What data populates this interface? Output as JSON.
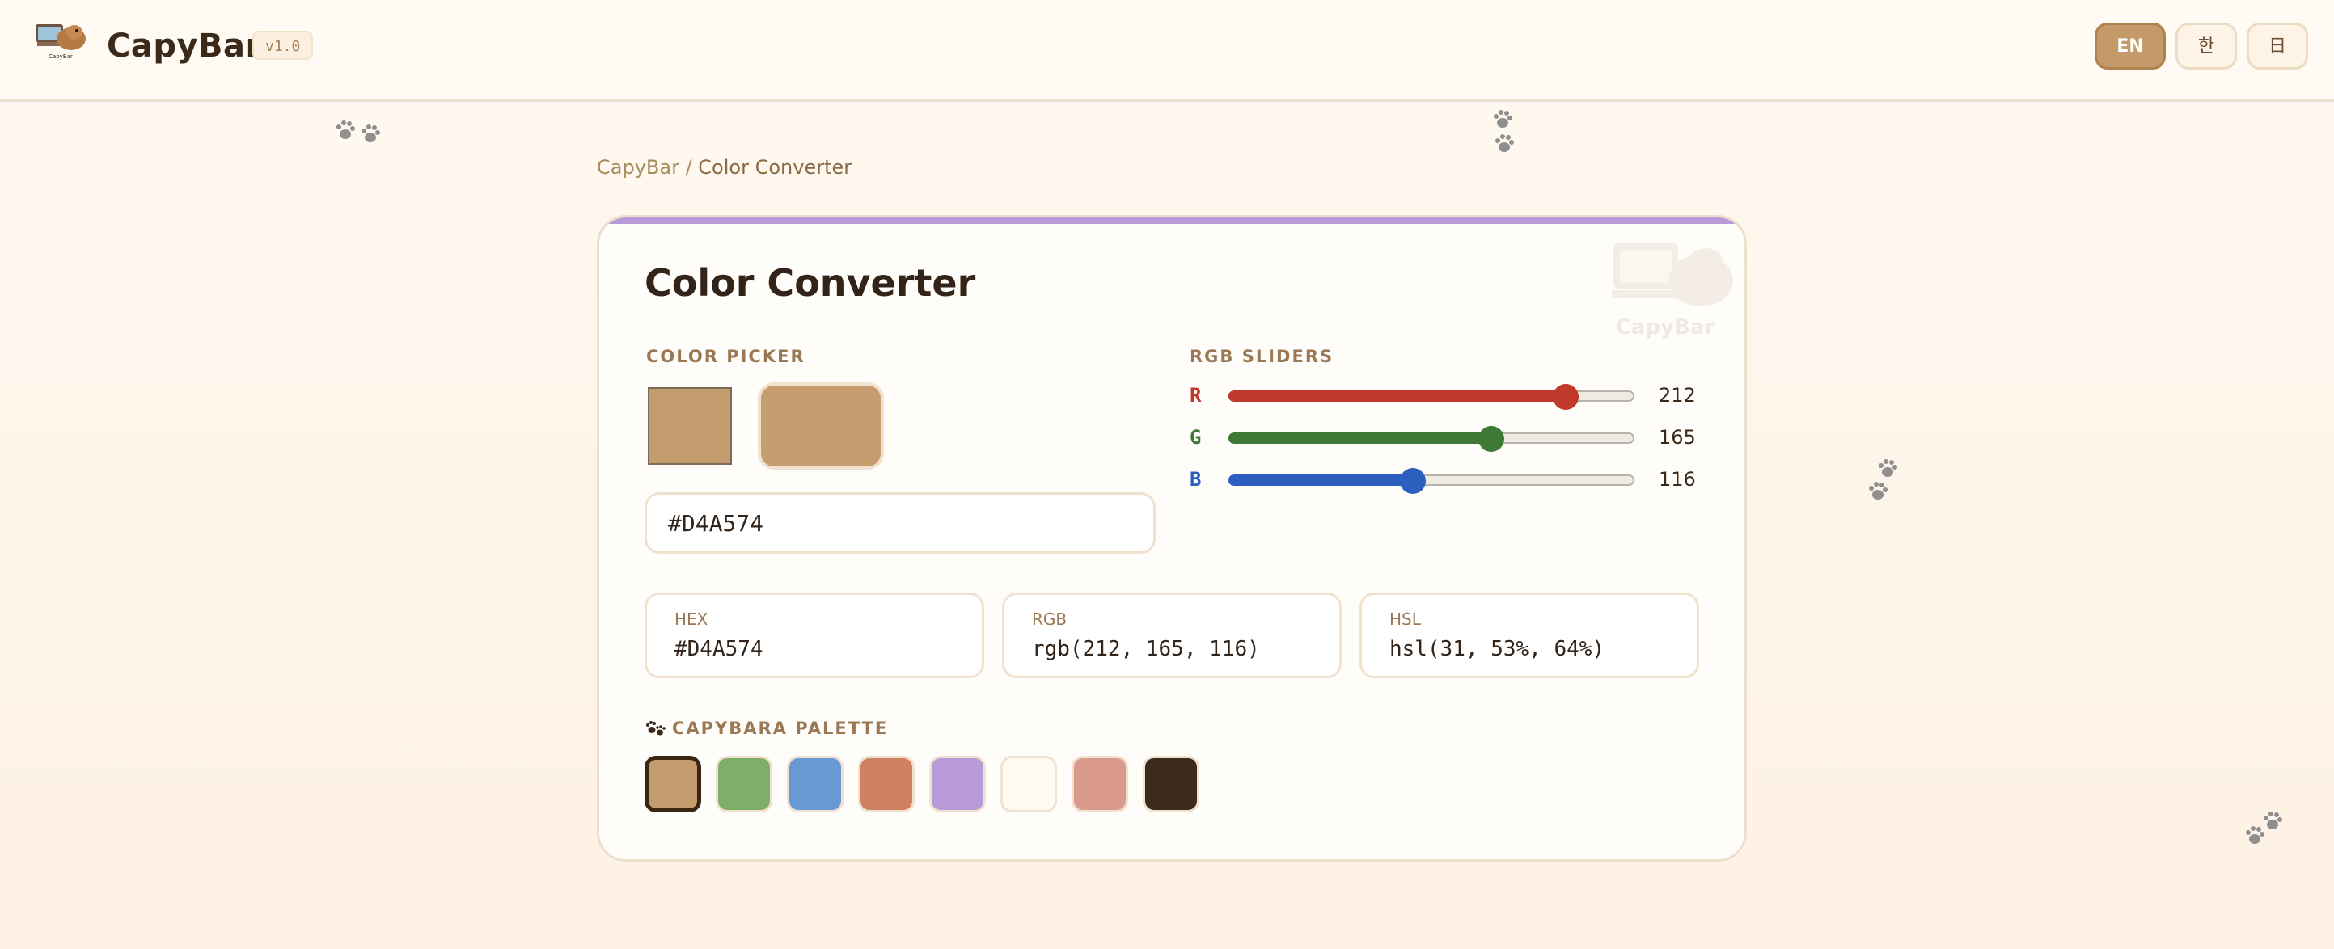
{
  "header": {
    "brand": "CapyBar",
    "version": "v1.0",
    "languages": [
      {
        "label": "EN",
        "active": true
      },
      {
        "label": "한",
        "active": false
      },
      {
        "label": "日",
        "active": false
      }
    ]
  },
  "breadcrumb": {
    "root": "CapyBar",
    "separator": " / ",
    "current": "Color Converter"
  },
  "card": {
    "title": "Color Converter",
    "mascot_label": "CapyBar",
    "picker_label": "COLOR PICKER",
    "sliders_label": "RGB SLIDERS",
    "hex_input_value": "#D4A574",
    "sliders": [
      {
        "letter": "R",
        "value": "212",
        "fraction": 0.831,
        "color": "#c0392b"
      },
      {
        "letter": "G",
        "value": "165",
        "fraction": 0.647,
        "color": "#3e7a36"
      },
      {
        "letter": "B",
        "value": "116",
        "fraction": 0.455,
        "color": "#2d5fbf"
      }
    ],
    "values": {
      "hex_label": "HEX",
      "hex_value": "#D4A574",
      "rgb_label": "RGB",
      "rgb_value": "rgb(212, 165, 116)",
      "hsl_label": "HSL",
      "hsl_value": "hsl(31, 53%, 64%)"
    },
    "palette_label": "CAPYBARA PALETTE",
    "palette": [
      {
        "color": "#c49d6e",
        "selected": true
      },
      {
        "color": "#7fae6a",
        "selected": false
      },
      {
        "color": "#6a98d4",
        "selected": false
      },
      {
        "color": "#cf7f62",
        "selected": false
      },
      {
        "color": "#b89ad8",
        "selected": false
      },
      {
        "color": "#fffaf1",
        "selected": false
      },
      {
        "color": "#d99a8b",
        "selected": false
      },
      {
        "color": "#3c2a1b",
        "selected": false
      }
    ]
  }
}
